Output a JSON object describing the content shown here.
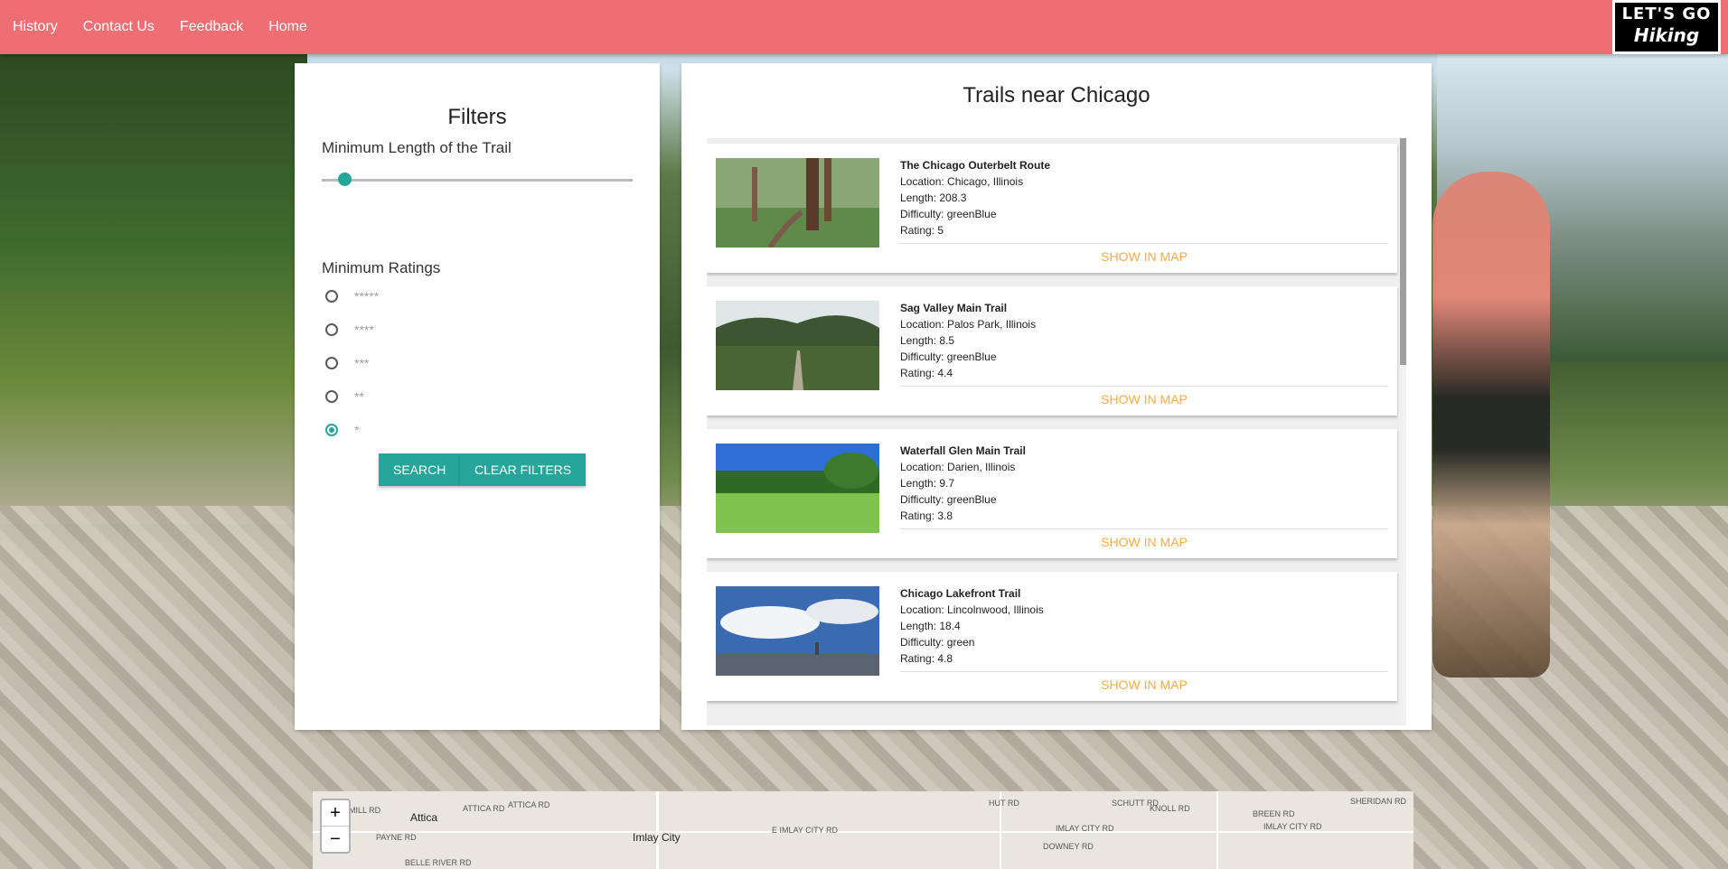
{
  "nav": {
    "links": [
      "History",
      "Contact Us",
      "Feedback",
      "Home"
    ],
    "logo_line1": "LET'S GO",
    "logo_line2": "Hiking"
  },
  "filters": {
    "title": "Filters",
    "length_label": "Minimum Length of the Trail",
    "length_value_fraction": 0.06,
    "ratings_label": "Minimum Ratings",
    "ratings": [
      {
        "label": "*****",
        "checked": false
      },
      {
        "label": "****",
        "checked": false
      },
      {
        "label": "***",
        "checked": false
      },
      {
        "label": "**",
        "checked": false
      },
      {
        "label": "*",
        "checked": true
      }
    ],
    "search_button": "Search",
    "clear_button": "Clear Filters"
  },
  "trails": {
    "title": "Trails near Chicago",
    "show_map_label": "Show in Map",
    "items": [
      {
        "name": "The Chicago Outerbelt Route",
        "location": "Location: Chicago, Illinois",
        "length": "Length: 208.3",
        "difficulty": "Difficulty: greenBlue",
        "rating": "Rating: 5",
        "image": "forest-path"
      },
      {
        "name": "Sag Valley Main Trail",
        "location": "Location: Palos Park, Illinois",
        "length": "Length: 8.5",
        "difficulty": "Difficulty: greenBlue",
        "rating": "Rating: 4.4",
        "image": "wooded-trail"
      },
      {
        "name": "Waterfall Glen Main Trail",
        "location": "Location: Darien, Illinois",
        "length": "Length: 9.7",
        "difficulty": "Difficulty: greenBlue",
        "rating": "Rating: 3.8",
        "image": "green-meadow"
      },
      {
        "name": "Chicago Lakefront Trail",
        "location": "Location: Lincolnwood, Illinois",
        "length": "Length: 18.4",
        "difficulty": "Difficulty: green",
        "rating": "Rating: 4.8",
        "image": "lakefront-sky"
      }
    ]
  },
  "map": {
    "zoom_in": "+",
    "zoom_out": "−",
    "cities": [
      "Attica",
      "Imlay City"
    ],
    "roads": [
      "MILL RD",
      "ATTICA RD",
      "ATTICA RD",
      "PAYNE RD",
      "BELLE RIVER RD",
      "E IMLAY CITY RD",
      "IMLAY CITY RD",
      "IMLAY CITY RD",
      "HUT RD",
      "SCHUTT RD",
      "KNOLL RD",
      "BREEN RD",
      "SHERIDAN RD",
      "DOWNEY RD"
    ]
  }
}
